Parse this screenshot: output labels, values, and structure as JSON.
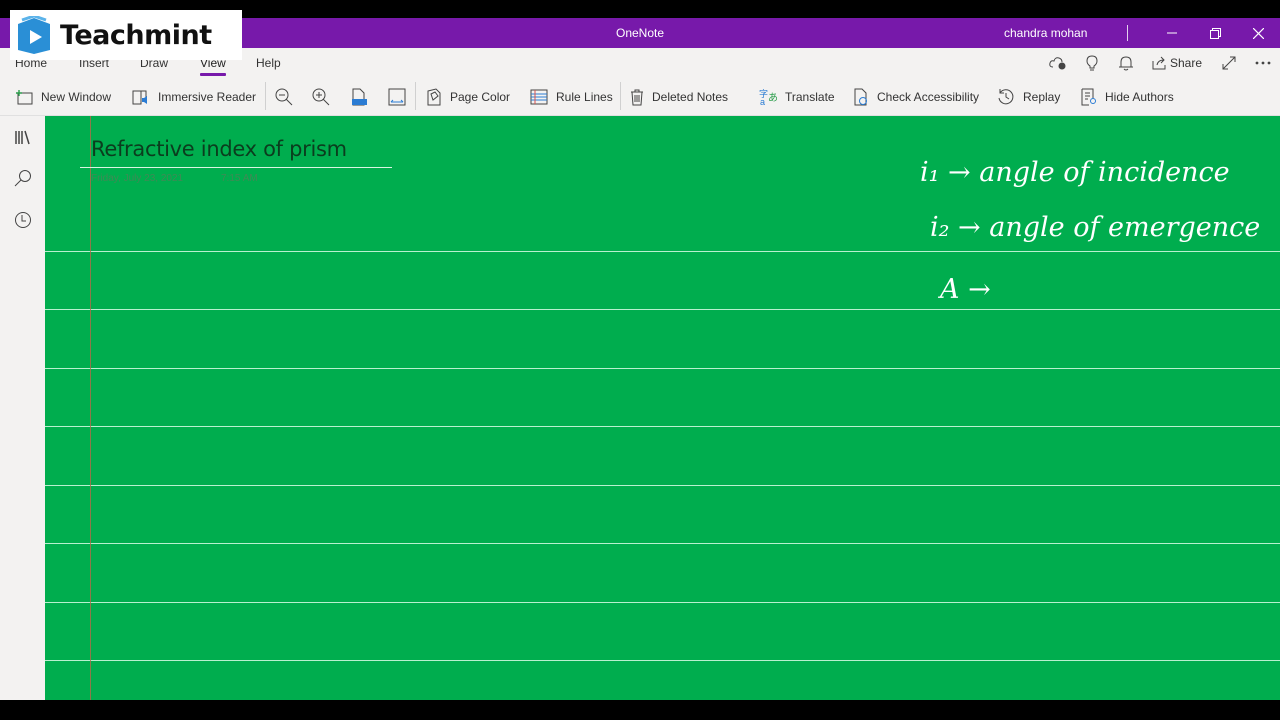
{
  "watermark": {
    "brand": "Teachmint"
  },
  "titlebar": {
    "app_title": "OneNote",
    "user_name": "chandra mohan",
    "controls": {
      "minimize": "minimize-icon",
      "restore": "restore-icon",
      "close": "close-icon"
    }
  },
  "menu": {
    "tabs": [
      {
        "label": "Home"
      },
      {
        "label": "Insert"
      },
      {
        "label": "Draw"
      },
      {
        "label": "View",
        "active": true
      },
      {
        "label": "Help"
      }
    ],
    "right": {
      "share_label": "Share"
    }
  },
  "toolbar": {
    "new_window": "New Window",
    "immersive_reader": "Immersive Reader",
    "page_color": "Page Color",
    "rule_lines": "Rule Lines",
    "deleted_notes": "Deleted Notes",
    "translate": "Translate",
    "check_accessibility": "Check Accessibility",
    "replay": "Replay",
    "hide_authors": "Hide Authors"
  },
  "page": {
    "title": "Refractive index of prism",
    "date": "Friday, July 23, 2021",
    "time": "7:15 AM",
    "background_color": "#00ad4e",
    "ink_notes": [
      {
        "text": "i₁ → angle of incidence"
      },
      {
        "text": "i₂ → angle of emergence"
      },
      {
        "text": "A →"
      }
    ]
  },
  "colors": {
    "accent": "#7719aa",
    "page": "#00ad4e",
    "chrome": "#f3f2f1"
  }
}
